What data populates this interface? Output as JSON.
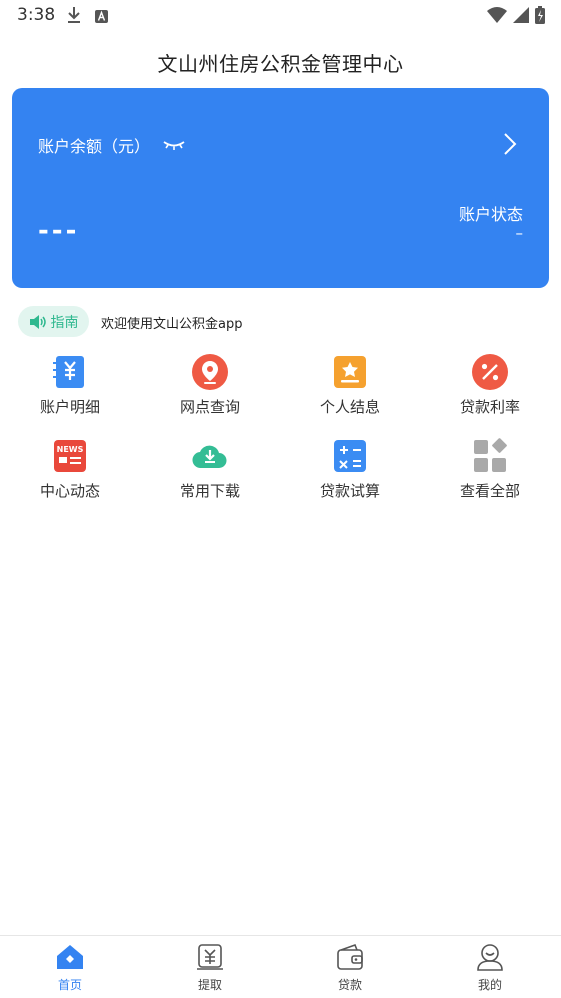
{
  "status": {
    "time": "3:38"
  },
  "header": {
    "title": "文山州住房公积金管理中心"
  },
  "card": {
    "balance_label": "账户余额（元）",
    "balance_value": "---",
    "status_label": "账户状态",
    "status_value": "–"
  },
  "notice": {
    "guide_label": "指南",
    "text": "欢迎使用文山公积金app"
  },
  "colors": {
    "primary": "#3483f1",
    "guide_green": "#2fb88f"
  },
  "grid": [
    {
      "label": "账户明细",
      "icon": "account-detail-icon"
    },
    {
      "label": "网点查询",
      "icon": "location-icon"
    },
    {
      "label": "个人结息",
      "icon": "interest-icon"
    },
    {
      "label": "贷款利率",
      "icon": "percent-icon"
    },
    {
      "label": "中心动态",
      "icon": "news-icon"
    },
    {
      "label": "常用下载",
      "icon": "cloud-download-icon"
    },
    {
      "label": "贷款试算",
      "icon": "calculator-icon"
    },
    {
      "label": "查看全部",
      "icon": "all-apps-icon"
    }
  ],
  "nav": [
    {
      "label": "首页",
      "icon": "home-icon"
    },
    {
      "label": "提取",
      "icon": "withdraw-icon"
    },
    {
      "label": "贷款",
      "icon": "wallet-icon"
    },
    {
      "label": "我的",
      "icon": "profile-icon"
    }
  ]
}
